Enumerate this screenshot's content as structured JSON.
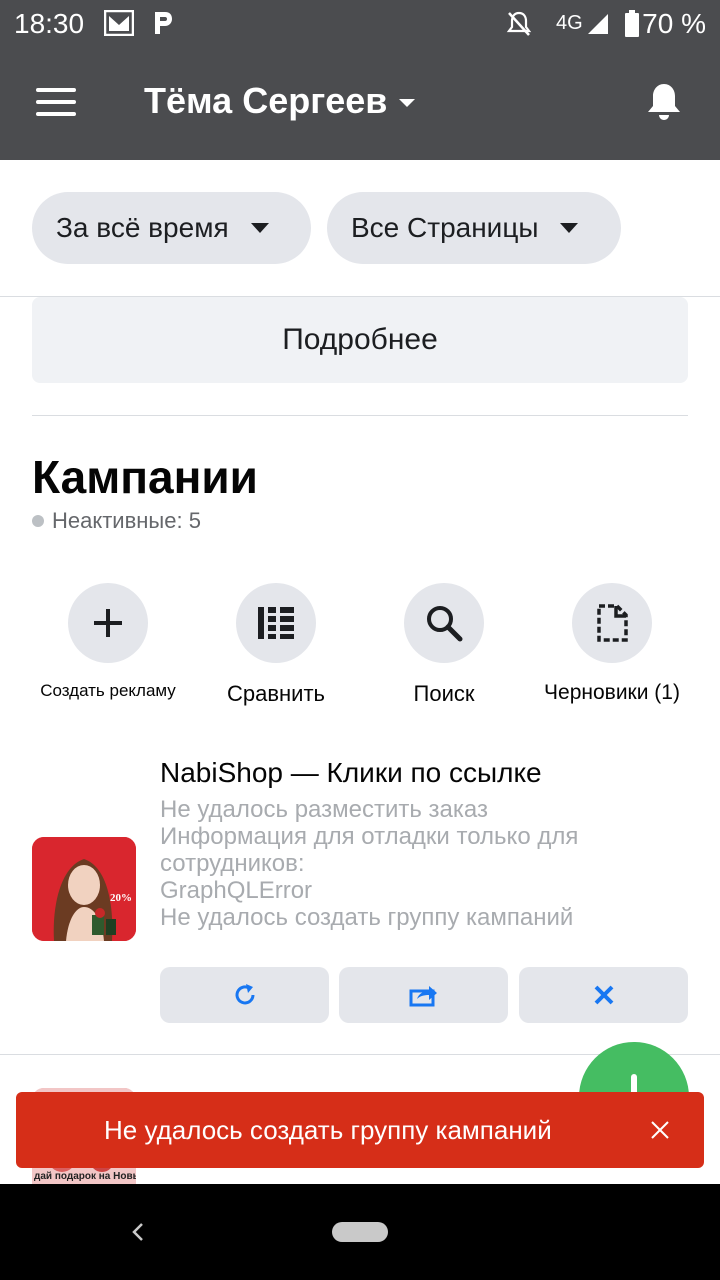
{
  "status_bar": {
    "time": "18:30",
    "network": "4G",
    "battery_percent": "70 %",
    "icons": [
      "gmail-icon",
      "app-p-icon",
      "mute-icon",
      "signal-icon",
      "battery-icon"
    ]
  },
  "app_bar": {
    "account_name": "Тёма Сергеев",
    "icons": [
      "menu-icon",
      "dropdown-caret-icon",
      "bell-icon"
    ]
  },
  "filters": {
    "period": "За всё время",
    "pages": "Все Страницы"
  },
  "details_button": "Подробнее",
  "campaigns": {
    "title": "Кампании",
    "inactive_label": "Неактивные: 5",
    "actions": [
      {
        "label": "Создать рекламу",
        "icon": "plus-icon"
      },
      {
        "label": "Сравнить",
        "icon": "compare-list-icon"
      },
      {
        "label": "Поиск",
        "icon": "search-icon"
      },
      {
        "label": "Черновики (1)",
        "icon": "draft-document-icon"
      }
    ]
  },
  "campaign_card": {
    "title": "NabiShop — Клики по ссылке",
    "error_lines": [
      "Не удалось разместить заказ",
      "Информация для отладки только для",
      "сотрудников:",
      "GraphQLError",
      "Не удалось создать группу кампаний"
    ],
    "thumbnail_badge": "20%",
    "buttons": [
      "retry-icon",
      "share-icon",
      "close-icon"
    ]
  },
  "second_card": {
    "thumbnail_text": "дай подарок на Новый Г"
  },
  "snackbar": {
    "message": "Не удалось создать группу кампаний"
  },
  "colors": {
    "app_bar": "#4b4c4f",
    "accent_blue": "#1877f2",
    "snackbar_red": "#d62e18",
    "fab_green": "#45bd62",
    "chip_gray": "#e4e6eb"
  }
}
